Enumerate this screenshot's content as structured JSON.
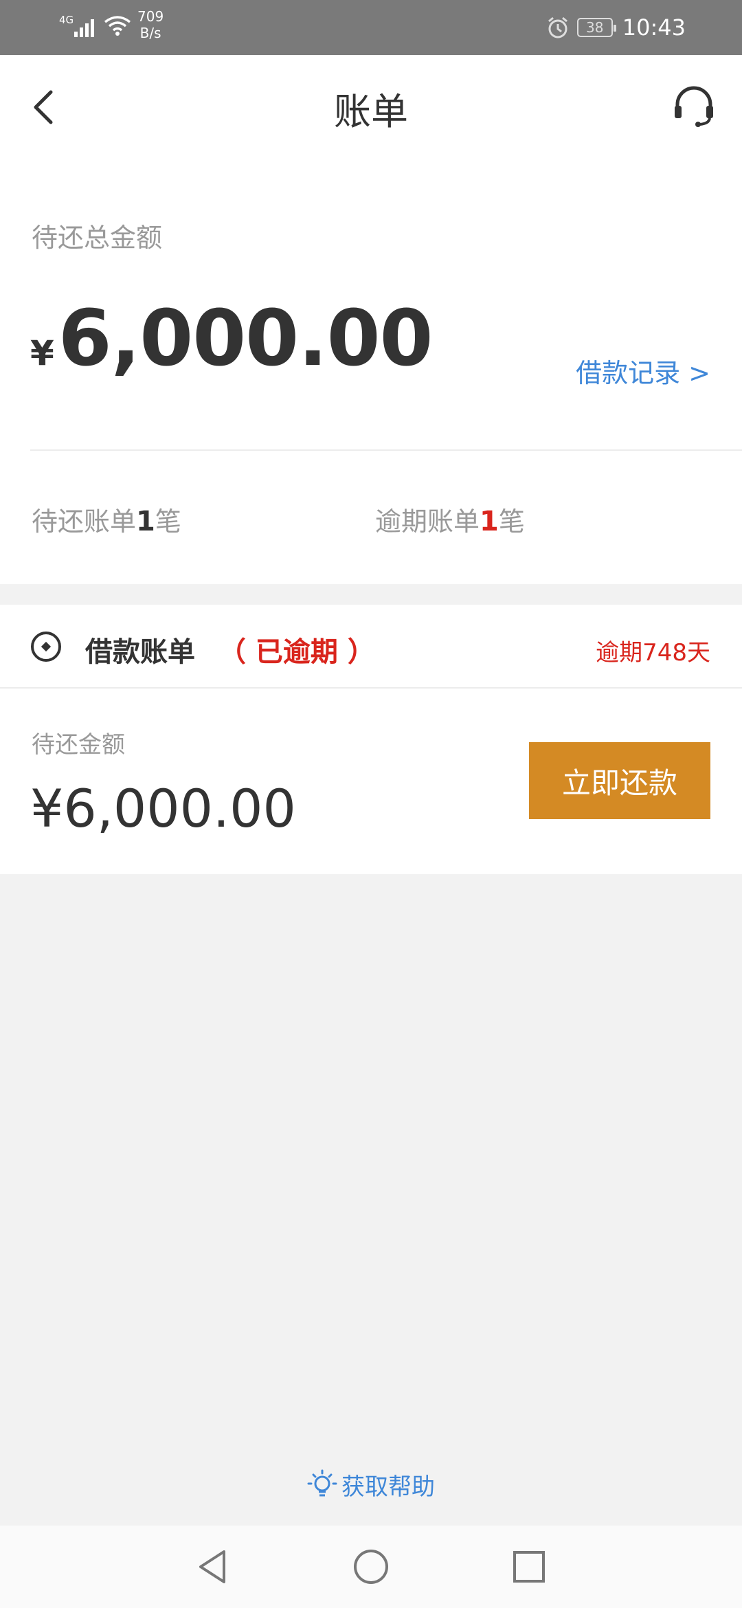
{
  "status_bar": {
    "network": "4G",
    "speed_value": "709",
    "speed_unit": "B/s",
    "battery": "38",
    "time": "10:43"
  },
  "header": {
    "title": "账单"
  },
  "summary": {
    "total_label": "待还总金额",
    "currency": "¥",
    "total_amount": "6,000.00",
    "records_link": "借款记录 >",
    "pending_prefix": "待还账单",
    "pending_count": "1",
    "pending_suffix": "笔",
    "overdue_prefix": "逾期账单",
    "overdue_count": "1",
    "overdue_suffix": "笔"
  },
  "bill": {
    "title": "借款账单",
    "status": "（ 已逾期 ）",
    "overdue_days": "逾期748天",
    "due_label": "待还金额",
    "due_amount": "¥6,000.00",
    "repay_button": "立即还款"
  },
  "help": {
    "label": "获取帮助"
  },
  "colors": {
    "accent_blue": "#3f87d8",
    "alert_red": "#d9251d",
    "button_orange": "#d48a24"
  },
  "icons": {
    "back": "chevron-left-icon",
    "customer_service": "headset-icon",
    "bill": "coin-icon",
    "help": "lightbulb-icon"
  }
}
